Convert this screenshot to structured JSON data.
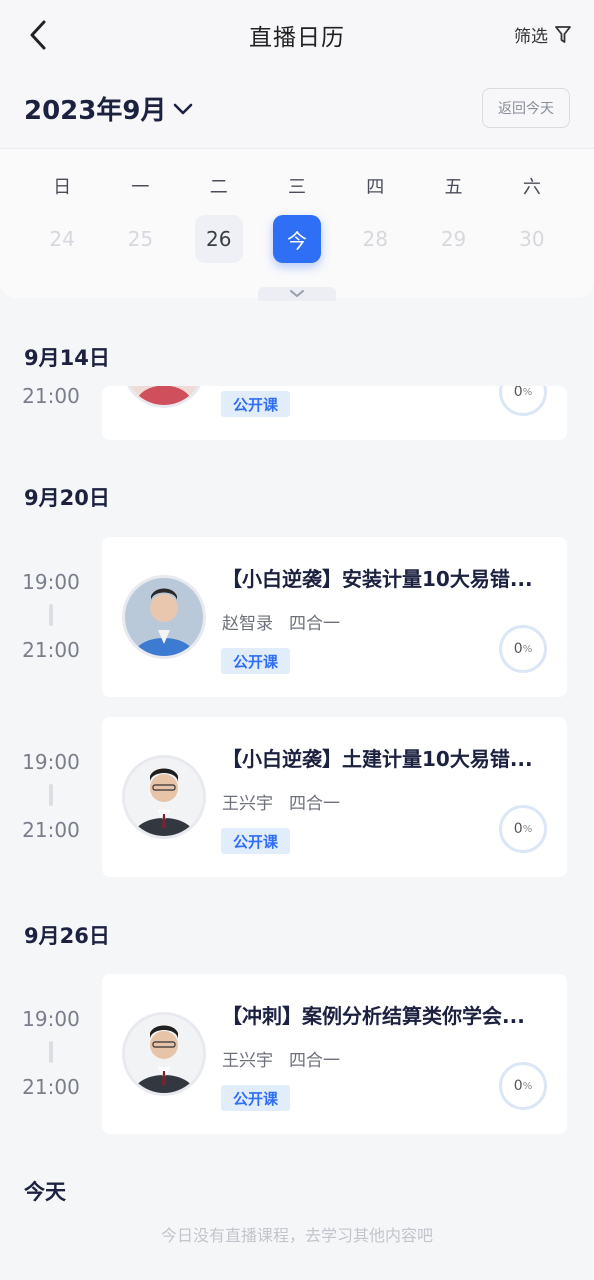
{
  "header": {
    "title": "直播日历",
    "filter_label": "筛选",
    "month_label": "2023年9月",
    "return_today_label": "返回今天"
  },
  "calendar": {
    "weekdays": [
      "日",
      "一",
      "二",
      "三",
      "四",
      "五",
      "六"
    ],
    "dates": [
      "24",
      "25",
      "26",
      "今",
      "28",
      "29",
      "30"
    ],
    "today_index": 3,
    "has_live_index": 2
  },
  "sections": [
    {
      "date_label": "9月14日",
      "items": [
        {
          "start": "",
          "end": "21:00",
          "title": "",
          "teacher": "",
          "category": "",
          "tag": "公开课",
          "progress": "0"
        }
      ]
    },
    {
      "date_label": "9月20日",
      "items": [
        {
          "start": "19:00",
          "end": "21:00",
          "title": "【小白逆袭】安装计量10大易错...",
          "teacher": "赵智录",
          "category": "四合一",
          "tag": "公开课",
          "progress": "0"
        },
        {
          "start": "19:00",
          "end": "21:00",
          "title": "【小白逆袭】土建计量10大易错...",
          "teacher": "王兴宇",
          "category": "四合一",
          "tag": "公开课",
          "progress": "0"
        }
      ]
    },
    {
      "date_label": "9月26日",
      "items": [
        {
          "start": "19:00",
          "end": "21:00",
          "title": "【冲刺】案例分析结算类你学会...",
          "teacher": "王兴宇",
          "category": "四合一",
          "tag": "公开课",
          "progress": "0"
        }
      ]
    },
    {
      "date_label": "今天",
      "empty_message": "今日没有直播课程，去学习其他内容吧"
    }
  ],
  "progress_unit": "%",
  "colors": {
    "accent": "#2f6ff5",
    "tag_bg": "#e2edfc"
  }
}
